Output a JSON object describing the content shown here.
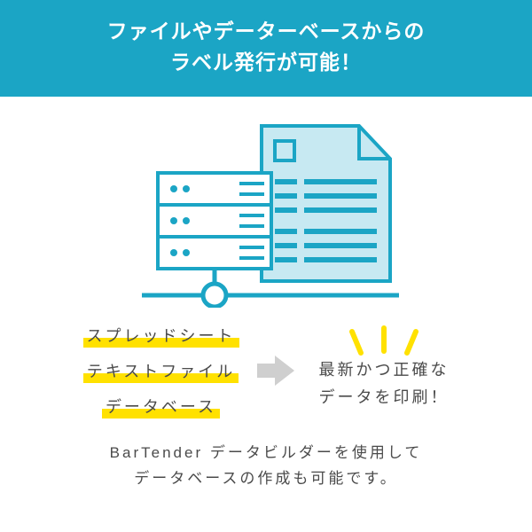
{
  "banner": {
    "line1": "ファイルやデーターベースからの",
    "line2": "ラベル発行が可能！"
  },
  "sources": {
    "item1": "スプレッドシート",
    "item2": "テキストファイル",
    "item3": "データベース"
  },
  "result": {
    "line1": "最新かつ正確な",
    "line2": "データを印刷！"
  },
  "footer": {
    "line1": "BarTender データビルダーを使用して",
    "line2": "データベースの作成も可能です。"
  },
  "colors": {
    "brand": "#1ba5c5",
    "highlight": "#ffe100",
    "accent": "#ffe100"
  }
}
